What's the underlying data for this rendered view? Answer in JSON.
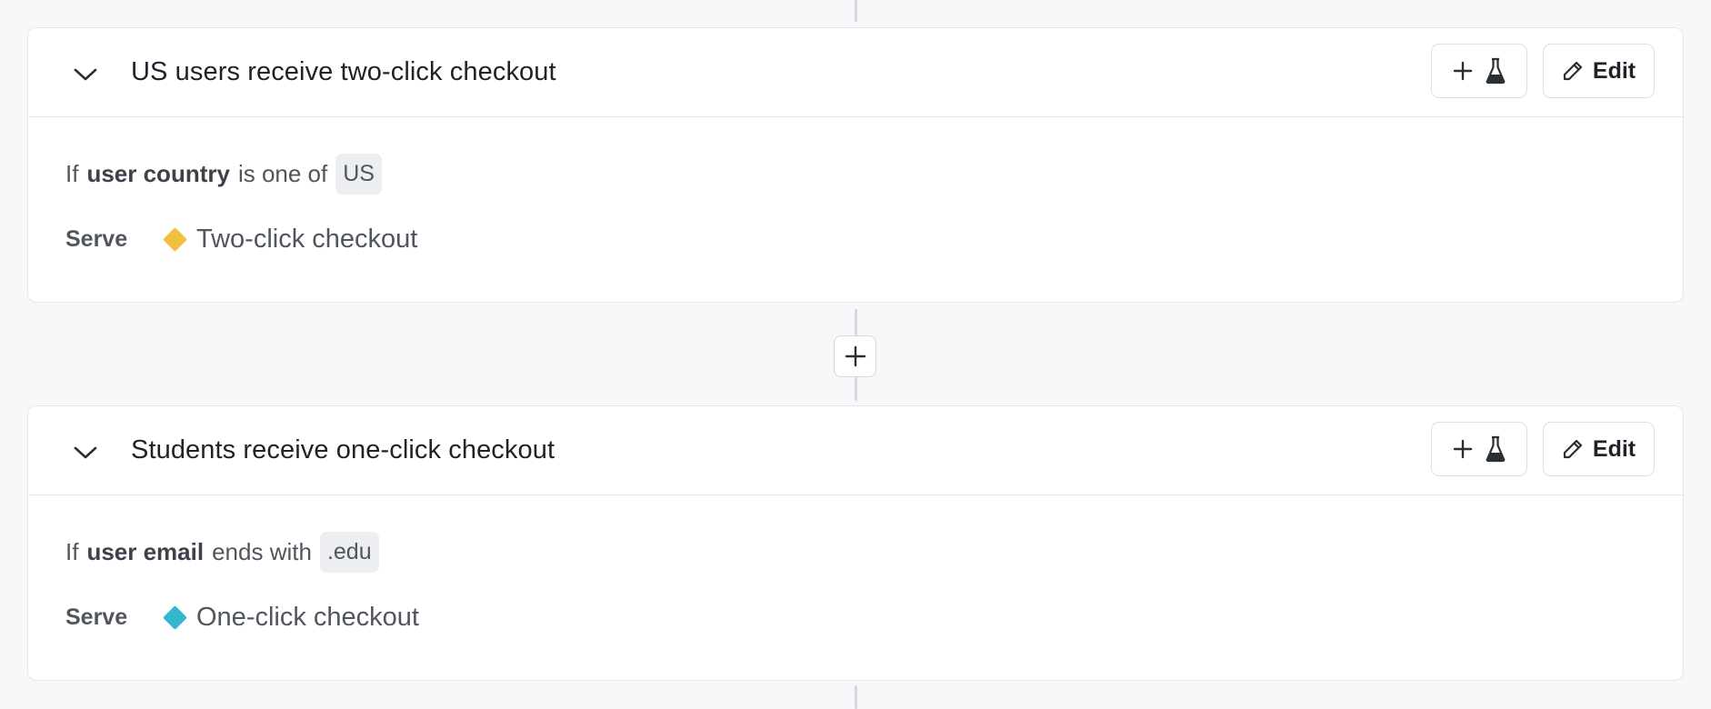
{
  "rules": [
    {
      "title": "US users receive two-click checkout",
      "condition": {
        "prefix": "If",
        "attribute": "user country",
        "operator": "is one of",
        "value": "US"
      },
      "serve": {
        "label": "Serve",
        "variation": "Two-click checkout",
        "color": "#f0bf3c"
      },
      "edit_label": "Edit"
    },
    {
      "title": "Students receive one-click checkout",
      "condition": {
        "prefix": "If",
        "attribute": "user email",
        "operator": "ends with",
        "value": ".edu"
      },
      "serve": {
        "label": "Serve",
        "variation": "One-click checkout",
        "color": "#35b6cf"
      },
      "edit_label": "Edit"
    }
  ],
  "icons": {
    "collapse": "chevron-down-icon",
    "add": "plus-icon",
    "experiment": "flask-icon",
    "edit": "pencil-icon"
  },
  "colors": {
    "background": "#f7f8fa",
    "card": "#ffffff",
    "border": "#e4e6ea",
    "chip": "#eceef1"
  }
}
